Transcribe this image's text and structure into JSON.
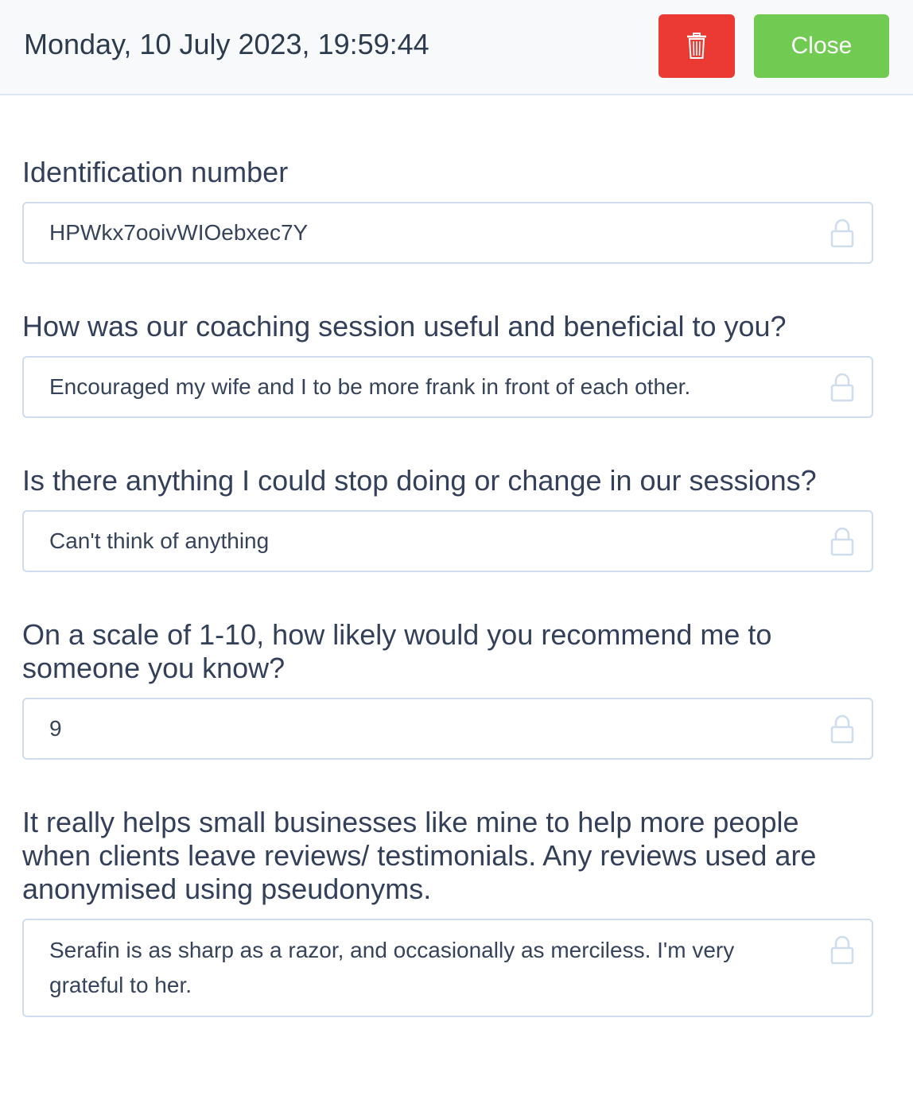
{
  "header": {
    "title": "Monday, 10 July 2023, 19:59:44",
    "delete_icon": "trash-icon",
    "close_label": "Close"
  },
  "colors": {
    "delete": "#ea3a33",
    "close": "#71cb52",
    "border": "#cfdceb"
  },
  "fields": [
    {
      "label": "Identification number",
      "value": "HPWkx7ooivWIOebxec7Y",
      "icon": "lock-icon"
    },
    {
      "label": "How was our coaching session useful and beneficial to you?",
      "value": "Encouraged my wife and I to be more frank in front of each other.",
      "icon": "lock-icon"
    },
    {
      "label": "Is there anything I could stop doing or change in our sessions?",
      "value": "Can't think of anything",
      "icon": "lock-icon"
    },
    {
      "label": "On a scale of 1-10, how likely would you recommend me to someone you know?",
      "value": "9",
      "icon": "lock-icon"
    },
    {
      "label": "It really helps small businesses like mine to help more people when clients leave reviews/ testimonials. Any reviews used are anonymised using pseudonyms.",
      "value": "Serafin is as sharp as a razor, and occasionally as merciless. I'm very grateful to her.",
      "icon": "lock-icon"
    }
  ]
}
